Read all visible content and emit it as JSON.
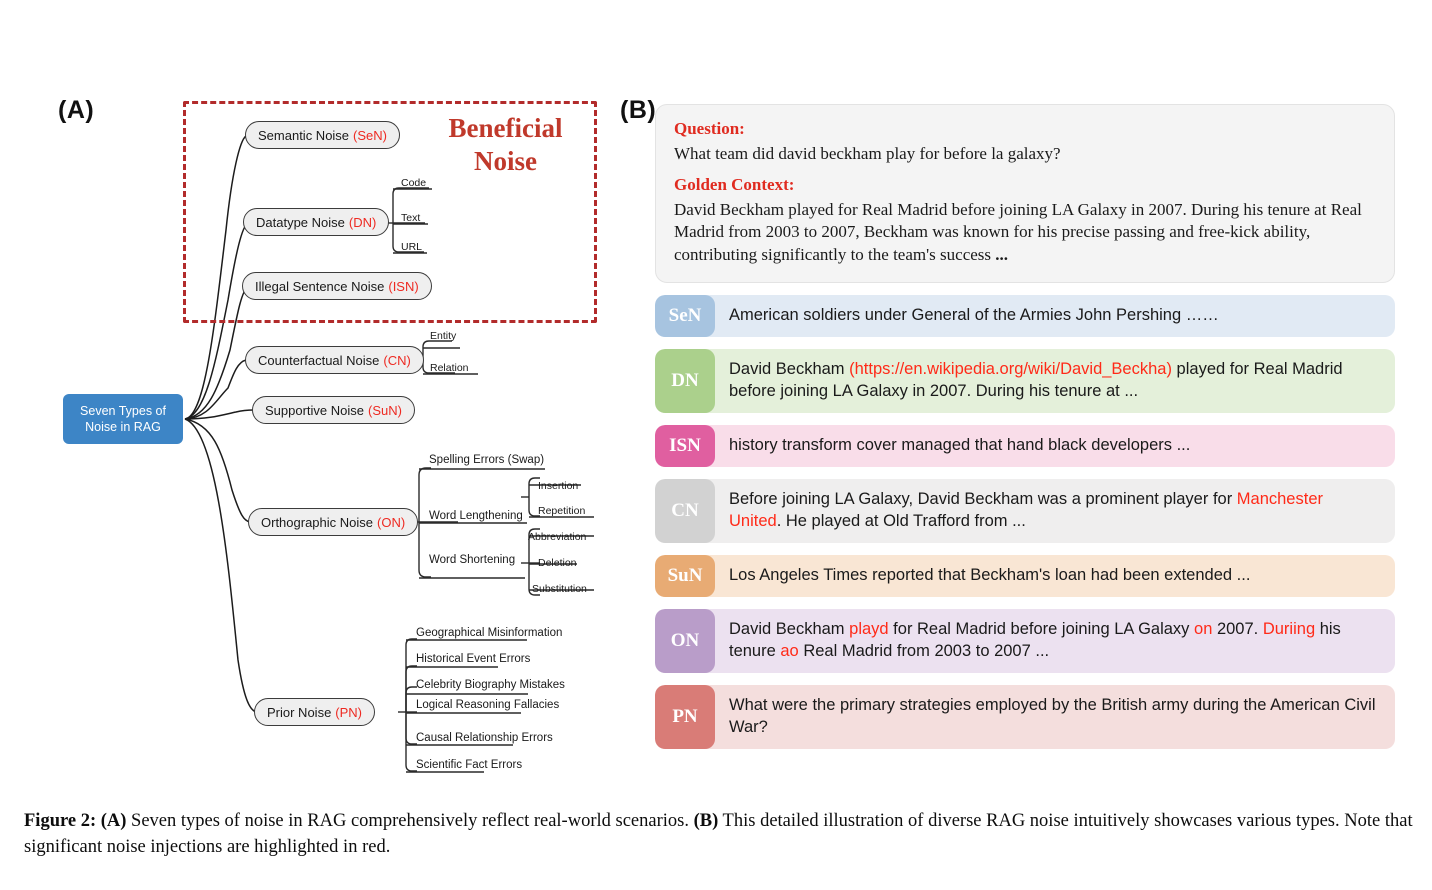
{
  "panels": {
    "a_label": "(A)",
    "b_label": "(B)"
  },
  "mindmap": {
    "root": "Seven Types of Noise in RAG",
    "beneficial_box_title": "Beneficial Noise",
    "beneficial_box_color": "#b22b2b",
    "root_color": "#3d85c6",
    "abbr_color": "#ee2a22",
    "nodes": [
      {
        "label": "Semantic Noise",
        "abbr": "(SeN)",
        "children": []
      },
      {
        "label": "Datatype Noise",
        "abbr": "(DN)",
        "children": [
          "Code",
          "Text",
          "URL"
        ]
      },
      {
        "label": "Illegal Sentence Noise",
        "abbr": "(ISN)",
        "children": []
      },
      {
        "label": "Counterfactual Noise",
        "abbr": "(CN)",
        "children": [
          "Entity",
          "Relation"
        ]
      },
      {
        "label": "Supportive Noise",
        "abbr": "(SuN)",
        "children": []
      },
      {
        "label": "Orthographic Noise",
        "abbr": "(ON)",
        "children": [
          "Spelling Errors (Swap)",
          "Word Lengthening",
          "Word Shortening"
        ]
      },
      {
        "label": "Prior Noise",
        "abbr": "(PN)",
        "children": [
          "Geographical Misinformation",
          "Historical Event Errors",
          "Celebrity Biography Mistakes",
          "Logical Reasoning Fallacies",
          "Causal Relationship Errors",
          "Scientific Fact Errors"
        ]
      }
    ],
    "orthographic_grandchildren": {
      "word_lengthening": [
        "Insertion",
        "Repetition"
      ],
      "word_shortening": [
        "Abbreviation",
        "Deletion",
        "Substitution"
      ]
    }
  },
  "examples": {
    "question_label": "Question:",
    "question_text": "What team did david beckham play for before la galaxy?",
    "golden_label": "Golden Context:",
    "golden_text": "David Beckham played for Real Madrid before joining LA Galaxy in 2007. During his tenure at Real Madrid from 2003 to 2007, Beckham was known for his precise passing and free-kick ability, contributing significantly to the team's success ",
    "golden_ellipsis": "...",
    "rows": [
      {
        "badge": "SeN",
        "badge_color": "#a7c4e0",
        "bg_color": "#e1eaf4",
        "parts": [
          {
            "t": "American soldiers under General of the Armies John Pershing ……",
            "hl": false
          }
        ]
      },
      {
        "badge": "DN",
        "badge_color": "#abd08c",
        "bg_color": "#e4f0da",
        "parts": [
          {
            "t": "David Beckham ",
            "hl": false
          },
          {
            "t": "(https://en.wikipedia.org/wiki/David_Beckha)",
            "hl": true
          },
          {
            "t": " played for Real Madrid before joining LA Galaxy in 2007. During his tenure at ...",
            "hl": false
          }
        ]
      },
      {
        "badge": "ISN",
        "badge_color": "#e05fa0",
        "bg_color": "#f9dde9",
        "parts": [
          {
            "t": "history transform cover managed that hand black developers ...",
            "hl": false
          }
        ]
      },
      {
        "badge": "CN",
        "badge_color": "#d2d2d2",
        "bg_color": "#efeeee",
        "parts": [
          {
            "t": "Before joining LA Galaxy, David Beckham was a prominent player for ",
            "hl": false
          },
          {
            "t": "Manchester United",
            "hl": true
          },
          {
            "t": ". He played at Old Trafford from ...",
            "hl": false
          }
        ]
      },
      {
        "badge": "SuN",
        "badge_color": "#e8ab74",
        "bg_color": "#f9e6d4",
        "parts": [
          {
            "t": "Los Angeles Times reported that Beckham's loan had been extended ...",
            "hl": false
          }
        ]
      },
      {
        "badge": "ON",
        "badge_color": "#b99dc9",
        "bg_color": "#ece1f0",
        "parts": [
          {
            "t": "David Beckham ",
            "hl": false
          },
          {
            "t": "playd",
            "hl": true
          },
          {
            "t": " for Real Madrid before joining LA Galaxy ",
            "hl": false
          },
          {
            "t": "on",
            "hl": true
          },
          {
            "t": " 2007. ",
            "hl": false
          },
          {
            "t": "Duriing",
            "hl": true
          },
          {
            "t": " his tenure ",
            "hl": false
          },
          {
            "t": "ao",
            "hl": true
          },
          {
            "t": " Real Madrid from 2003 to 2007 ...",
            "hl": false
          }
        ]
      },
      {
        "badge": "PN",
        "badge_color": "#d97c77",
        "bg_color": "#f4dedd",
        "parts": [
          {
            "t": "What were the primary strategies employed by the British army during the American Civil War?",
            "hl": false
          }
        ]
      }
    ]
  },
  "caption": {
    "figure_number": "Figure 2:",
    "a_tag": "(A)",
    "a_text": " Seven types of noise in RAG comprehensively reflect real-world scenarios. ",
    "b_tag": "(B)",
    "b_text": " This detailed illustration of diverse RAG noise intuitively showcases various types. Note that significant noise injections are highlighted in red."
  }
}
